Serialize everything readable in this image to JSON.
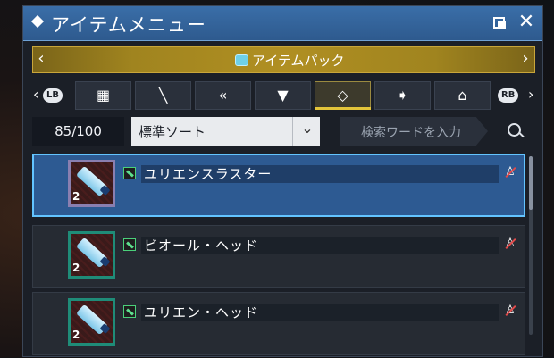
{
  "window": {
    "title": "アイテムメニュー"
  },
  "pack": {
    "label": "アイテムパック",
    "left_arrow": "‹",
    "right_arrow": "›"
  },
  "categories": {
    "lb": "LB",
    "rb": "RB",
    "left_arrow": "‹",
    "right_arrow": "›",
    "tabs": [
      {
        "name": "all-items-icon",
        "glyph": "▦"
      },
      {
        "name": "weapon-icon",
        "glyph": "⟋"
      },
      {
        "name": "unit-icon",
        "glyph": "«"
      },
      {
        "name": "costume-icon",
        "glyph": "👕"
      },
      {
        "name": "tag-icon",
        "glyph": "⬭"
      },
      {
        "name": "direction-icon",
        "glyph": "◈"
      },
      {
        "name": "room-icon",
        "glyph": "⌂"
      }
    ],
    "active_index": 4
  },
  "filter": {
    "count": "85/100",
    "sort_label": "標準ソート",
    "search_placeholder": "検索ワードを入力"
  },
  "items": [
    {
      "name": "ユリエンスラスター",
      "qty": "2",
      "selected": true
    },
    {
      "name": "ビオール・ヘッド",
      "qty": "2",
      "selected": false
    },
    {
      "name": "ユリエン・ヘッド",
      "qty": "2",
      "selected": false
    }
  ],
  "colors": {
    "accent_gold": "#e3c43a",
    "selected_row": "#2d5a92",
    "selected_border": "#63c4ff"
  }
}
